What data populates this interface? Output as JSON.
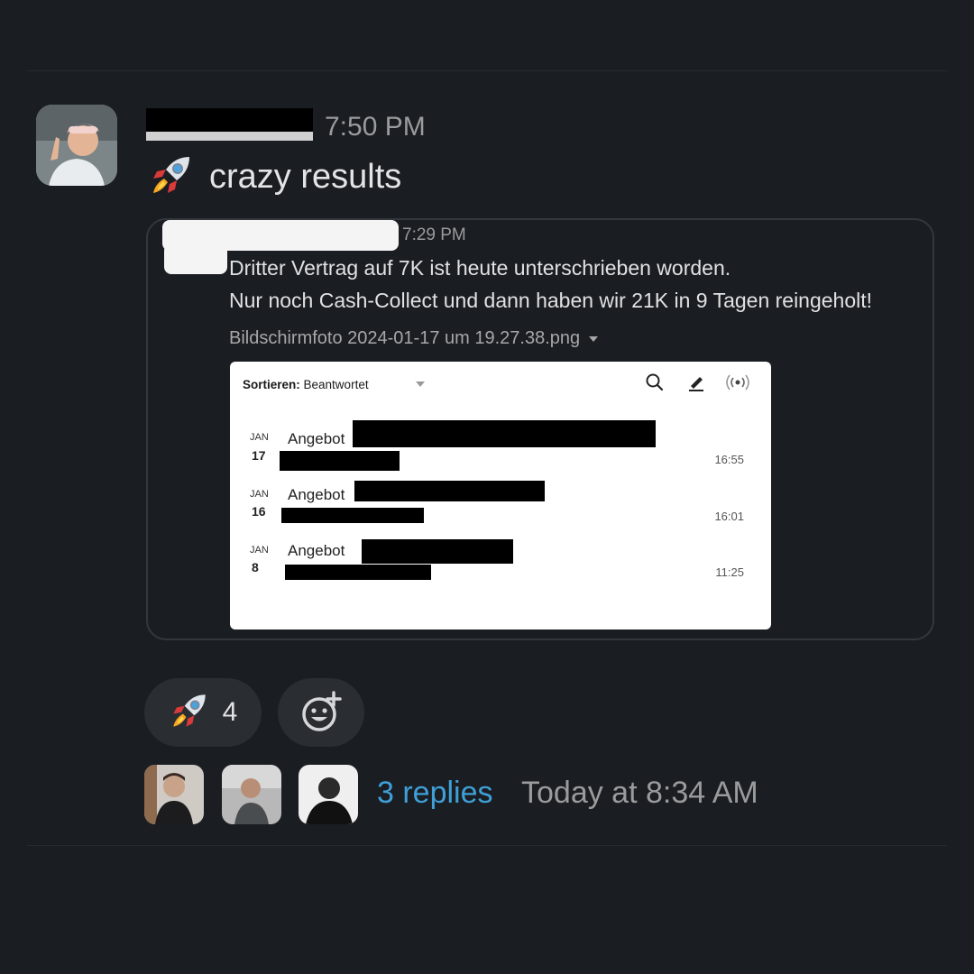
{
  "message": {
    "time": "7:50 PM",
    "emoji_icon": "rocket-icon",
    "text": "crazy results"
  },
  "quoted": {
    "time": "7:29 PM",
    "line1": "Dritter Vertrag auf 7K ist heute unterschrieben worden.",
    "line2": "Nur noch Cash-Collect und dann haben wir 21K in 9 Tagen reingeholt!",
    "file_name": "Bildschirmfoto 2024-01-17 um 19.27.38.png"
  },
  "screenshot": {
    "sort_label": "Sortieren:",
    "sort_value": "Beantwortet",
    "rows": [
      {
        "month": "JAN",
        "day": "17",
        "title": "Angebot",
        "time": "16:55"
      },
      {
        "month": "JAN",
        "day": "16",
        "title": "Angebot",
        "time": "16:01"
      },
      {
        "month": "JAN",
        "day": "8",
        "title": "Angebot",
        "time": "11:25"
      }
    ]
  },
  "reactions": {
    "rocket_count": "4",
    "add_reaction_icon": "add-reaction-icon"
  },
  "thread": {
    "replies": "3 replies",
    "last_reply": "Today at 8:34 AM"
  },
  "colors": {
    "background": "#1a1d21",
    "link": "#3fa0d8",
    "muted": "#9a9b9d"
  }
}
